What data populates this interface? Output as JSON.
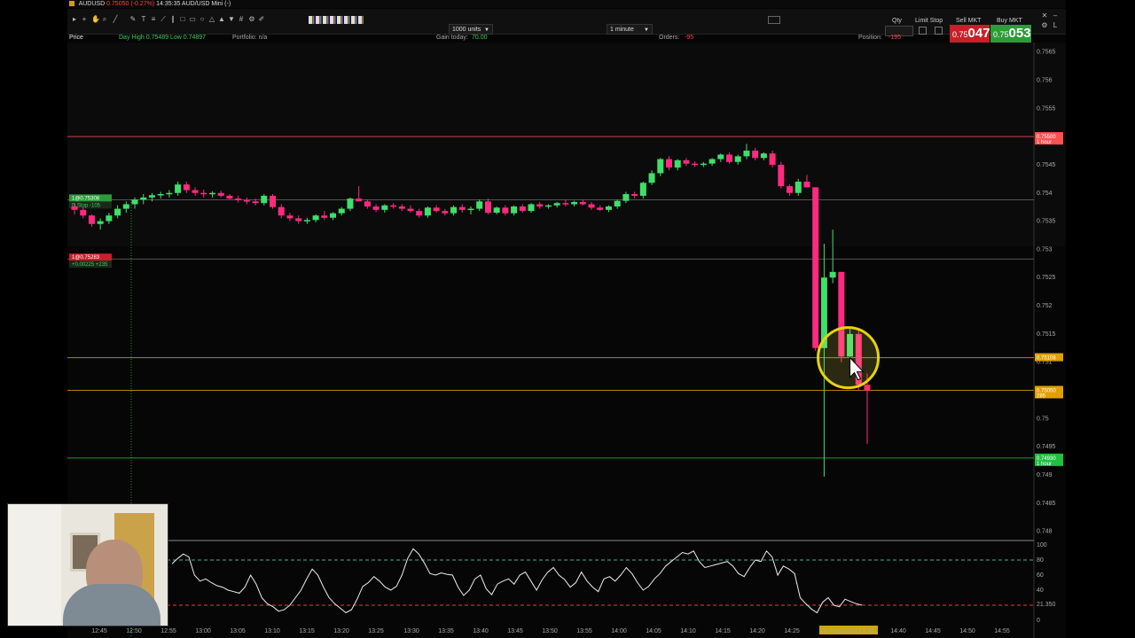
{
  "window": {
    "title_symbol": "AUDUSD",
    "title_change": "0.75050 (-0.27%)",
    "title_rest": "14:35:35 AUD/USD Mini (-)"
  },
  "toolbar": {
    "units_select": "1000 units",
    "interval_select": "1 minute",
    "qty_label": "Qty",
    "limit_stop_label": "Limit Stop",
    "sell_label": "Sell MKT",
    "buy_label": "Buy MKT",
    "sell_price_prefix": "0.75",
    "sell_price_big": "047",
    "buy_price_prefix": "0.75",
    "buy_price_big": "053",
    "sell_color": "#c8202a",
    "buy_color": "#2e9b3a"
  },
  "infobar": {
    "price_label": "Price",
    "day_range": "Day High 0.75489 Low 0.74897",
    "portfolio": "Portfolio: n/a",
    "gain_label": "Gain today:",
    "gain_value": "70.00",
    "orders_label": "Orders:",
    "orders_value": "-95",
    "position_label": "Position:",
    "position_value": "-195"
  },
  "chart_data": [
    {
      "type": "candlestick",
      "symbol": "AUDUSD",
      "timeframe": "1 minute",
      "ylim": [
        0.7479,
        0.7564
      ],
      "y_ticks": [
        "0.7565",
        "0.756",
        "0.7555",
        "0.755",
        "0.7545",
        "0.754",
        "0.7535",
        "0.753",
        "0.7525",
        "0.752",
        "0.7515",
        "0.751",
        "0.7505",
        "0.75",
        "0.7495",
        "0.749",
        "0.7485",
        "0.748"
      ],
      "x_ticks": [
        "12:45",
        "12:50",
        "12:55",
        "13:00",
        "13:05",
        "13:10",
        "13:15",
        "13:20",
        "13:25",
        "13:30",
        "13:35",
        "13:40",
        "13:45",
        "13:50",
        "13:55",
        "14:00",
        "14:05",
        "14:10",
        "14:15",
        "14:20",
        "14:25",
        "02-Aug-2018 14:33",
        "14:40",
        "14:45",
        "14:50",
        "14:55"
      ],
      "price_lines": [
        {
          "price": 0.755,
          "label": "0.75500",
          "sub": "1 hour",
          "color": "#ff5050"
        },
        {
          "price": 0.75108,
          "label": "0.75108",
          "color": "#e0a000"
        },
        {
          "price": 0.7505,
          "label": "0.75050",
          "sub": "285",
          "color": "#e0a000"
        },
        {
          "price": 0.7493,
          "label": "0.74930",
          "sub": "1 hour",
          "color": "#20c040"
        }
      ],
      "orders": [
        {
          "price": 0.75388,
          "label": "1@0.75308",
          "sub": "D.Stop -105",
          "color": "#2e9b3a"
        },
        {
          "price": 0.75283,
          "label": "1@0.75283",
          "sub": "+0.00225 +235",
          "color": "#c8202a"
        }
      ],
      "candles": [
        [
          0.75376,
          0.75382,
          0.75362,
          0.7537
        ],
        [
          0.7537,
          0.75375,
          0.75355,
          0.7536
        ],
        [
          0.7536,
          0.75362,
          0.7534,
          0.75345
        ],
        [
          0.75345,
          0.75355,
          0.75335,
          0.7535
        ],
        [
          0.7535,
          0.75365,
          0.75345,
          0.7536
        ],
        [
          0.7536,
          0.75378,
          0.75355,
          0.75372
        ],
        [
          0.75372,
          0.75385,
          0.75365,
          0.7538
        ],
        [
          0.7538,
          0.75392,
          0.75372,
          0.75388
        ],
        [
          0.75388,
          0.75398,
          0.7538,
          0.75392
        ],
        [
          0.75392,
          0.754,
          0.75385,
          0.75396
        ],
        [
          0.75396,
          0.75402,
          0.7539,
          0.75398
        ],
        [
          0.75398,
          0.75405,
          0.75392,
          0.754
        ],
        [
          0.754,
          0.7542,
          0.75395,
          0.75415
        ],
        [
          0.75415,
          0.7542,
          0.754,
          0.75405
        ],
        [
          0.75405,
          0.7541,
          0.75395,
          0.754
        ],
        [
          0.754,
          0.75406,
          0.75392,
          0.75398
        ],
        [
          0.75398,
          0.75403,
          0.75392,
          0.754
        ],
        [
          0.754,
          0.75404,
          0.75392,
          0.75395
        ],
        [
          0.75395,
          0.75398,
          0.75388,
          0.7539
        ],
        [
          0.7539,
          0.75395,
          0.75383,
          0.75387
        ],
        [
          0.75387,
          0.75392,
          0.7538,
          0.75385
        ],
        [
          0.75385,
          0.7539,
          0.75378,
          0.75382
        ],
        [
          0.75382,
          0.75398,
          0.75378,
          0.75395
        ],
        [
          0.75395,
          0.75398,
          0.75372,
          0.75375
        ],
        [
          0.75375,
          0.7538,
          0.75355,
          0.7536
        ],
        [
          0.7536,
          0.75365,
          0.7535,
          0.75355
        ],
        [
          0.75355,
          0.7536,
          0.75345,
          0.7535
        ],
        [
          0.7535,
          0.75356,
          0.75345,
          0.75352
        ],
        [
          0.75352,
          0.75362,
          0.75348,
          0.7536
        ],
        [
          0.7536,
          0.75368,
          0.75352,
          0.75356
        ],
        [
          0.75356,
          0.75366,
          0.75352,
          0.75364
        ],
        [
          0.75364,
          0.75375,
          0.7536,
          0.75372
        ],
        [
          0.75372,
          0.75392,
          0.75368,
          0.7539
        ],
        [
          0.7539,
          0.75412,
          0.75386,
          0.75385
        ],
        [
          0.75385,
          0.75388,
          0.75372,
          0.75376
        ],
        [
          0.75376,
          0.7538,
          0.75366,
          0.7537
        ],
        [
          0.7537,
          0.7538,
          0.75365,
          0.75378
        ],
        [
          0.75378,
          0.75382,
          0.75372,
          0.75376
        ],
        [
          0.75376,
          0.7538,
          0.75368,
          0.75372
        ],
        [
          0.75372,
          0.75378,
          0.75365,
          0.75368
        ],
        [
          0.75368,
          0.75372,
          0.75356,
          0.7536
        ],
        [
          0.7536,
          0.75376,
          0.75356,
          0.75374
        ],
        [
          0.75374,
          0.75378,
          0.75365,
          0.75368
        ],
        [
          0.75368,
          0.75372,
          0.7536,
          0.75364
        ],
        [
          0.75364,
          0.75378,
          0.7536,
          0.75375
        ],
        [
          0.75375,
          0.7538,
          0.75365,
          0.7537
        ],
        [
          0.7537,
          0.75376,
          0.75362,
          0.75372
        ],
        [
          0.75372,
          0.75388,
          0.75368,
          0.75385
        ],
        [
          0.75385,
          0.7539,
          0.75362,
          0.75365
        ],
        [
          0.75365,
          0.75376,
          0.75362,
          0.75374
        ],
        [
          0.75374,
          0.75378,
          0.7536,
          0.75364
        ],
        [
          0.75364,
          0.75378,
          0.7536,
          0.75376
        ],
        [
          0.75376,
          0.7538,
          0.75365,
          0.75368
        ],
        [
          0.75368,
          0.75382,
          0.75365,
          0.7538
        ],
        [
          0.7538,
          0.75384,
          0.75372,
          0.75376
        ],
        [
          0.75376,
          0.7538,
          0.75372,
          0.75378
        ],
        [
          0.75378,
          0.75384,
          0.75374,
          0.75382
        ],
        [
          0.75382,
          0.75388,
          0.75376,
          0.7538
        ],
        [
          0.7538,
          0.75386,
          0.75376,
          0.75384
        ],
        [
          0.75384,
          0.75388,
          0.75378,
          0.7538
        ],
        [
          0.7538,
          0.75384,
          0.7537,
          0.75374
        ],
        [
          0.75374,
          0.75378,
          0.75368,
          0.7537
        ],
        [
          0.7537,
          0.75378,
          0.75366,
          0.75376
        ],
        [
          0.75376,
          0.75388,
          0.75372,
          0.75386
        ],
        [
          0.75386,
          0.75402,
          0.75382,
          0.75398
        ],
        [
          0.75398,
          0.75402,
          0.7539,
          0.75395
        ],
        [
          0.75395,
          0.7542,
          0.7539,
          0.75418
        ],
        [
          0.75418,
          0.7544,
          0.75414,
          0.75435
        ],
        [
          0.75435,
          0.75462,
          0.7543,
          0.7546
        ],
        [
          0.7546,
          0.75465,
          0.7544,
          0.75445
        ],
        [
          0.75445,
          0.7546,
          0.7544,
          0.75458
        ],
        [
          0.75458,
          0.75462,
          0.75448,
          0.75452
        ],
        [
          0.75452,
          0.75456,
          0.75446,
          0.7545
        ],
        [
          0.7545,
          0.75455,
          0.75446,
          0.75452
        ],
        [
          0.75452,
          0.75462,
          0.75448,
          0.7546
        ],
        [
          0.7546,
          0.7547,
          0.75455,
          0.75468
        ],
        [
          0.75468,
          0.75472,
          0.75452,
          0.75455
        ],
        [
          0.75455,
          0.75468,
          0.7545,
          0.75465
        ],
        [
          0.75465,
          0.75487,
          0.7546,
          0.75475
        ],
        [
          0.75475,
          0.7548,
          0.75458,
          0.75462
        ],
        [
          0.75462,
          0.75472,
          0.75458,
          0.7547
        ],
        [
          0.7547,
          0.75475,
          0.75445,
          0.7545
        ],
        [
          0.7545,
          0.75455,
          0.75408,
          0.75412
        ],
        [
          0.75412,
          0.75415,
          0.75395,
          0.754
        ],
        [
          0.754,
          0.75425,
          0.75395,
          0.7542
        ],
        [
          0.7542,
          0.75432,
          0.7541,
          0.7541
        ],
        [
          0.7541,
          0.7541,
          0.7512,
          0.75125
        ],
        [
          0.75125,
          0.7531,
          0.74897,
          0.7525
        ],
        [
          0.7525,
          0.75335,
          0.7524,
          0.7526
        ],
        [
          0.7526,
          0.7526,
          0.751,
          0.7511
        ],
        [
          0.7511,
          0.7516,
          0.751,
          0.7515
        ],
        [
          0.7515,
          0.7516,
          0.7505,
          0.7506
        ],
        [
          0.7506,
          0.7508,
          0.74955,
          0.7505
        ]
      ]
    },
    {
      "type": "line",
      "name": "oscillator",
      "ylim": [
        0,
        100
      ],
      "y_ticks": [
        "100",
        "80",
        "60",
        "40",
        "21.350",
        "0"
      ],
      "levels": [
        80,
        20
      ],
      "values": [
        75,
        82,
        88,
        84,
        60,
        52,
        55,
        50,
        46,
        44,
        40,
        38,
        36,
        44,
        60,
        48,
        30,
        22,
        18,
        12,
        14,
        20,
        30,
        40,
        55,
        68,
        60,
        44,
        30,
        22,
        16,
        10,
        14,
        28,
        45,
        50,
        58,
        52,
        44,
        40,
        45,
        60,
        82,
        95,
        88,
        76,
        62,
        60,
        63,
        61,
        60,
        44,
        33,
        40,
        55,
        60,
        42,
        34,
        48,
        52,
        55,
        48,
        60,
        64,
        52,
        40,
        54,
        64,
        70,
        60,
        54,
        44,
        50,
        64,
        52,
        44,
        38,
        55,
        58,
        52,
        60,
        70,
        62,
        50,
        40,
        45,
        55,
        62,
        72,
        78,
        84,
        90,
        88,
        92,
        78,
        70,
        72,
        74,
        76,
        78,
        72,
        62,
        58,
        70,
        80,
        78,
        92,
        84,
        60,
        72,
        68,
        62,
        30,
        22,
        15,
        10,
        24,
        30,
        20,
        18,
        28,
        25,
        22,
        20
      ]
    }
  ]
}
